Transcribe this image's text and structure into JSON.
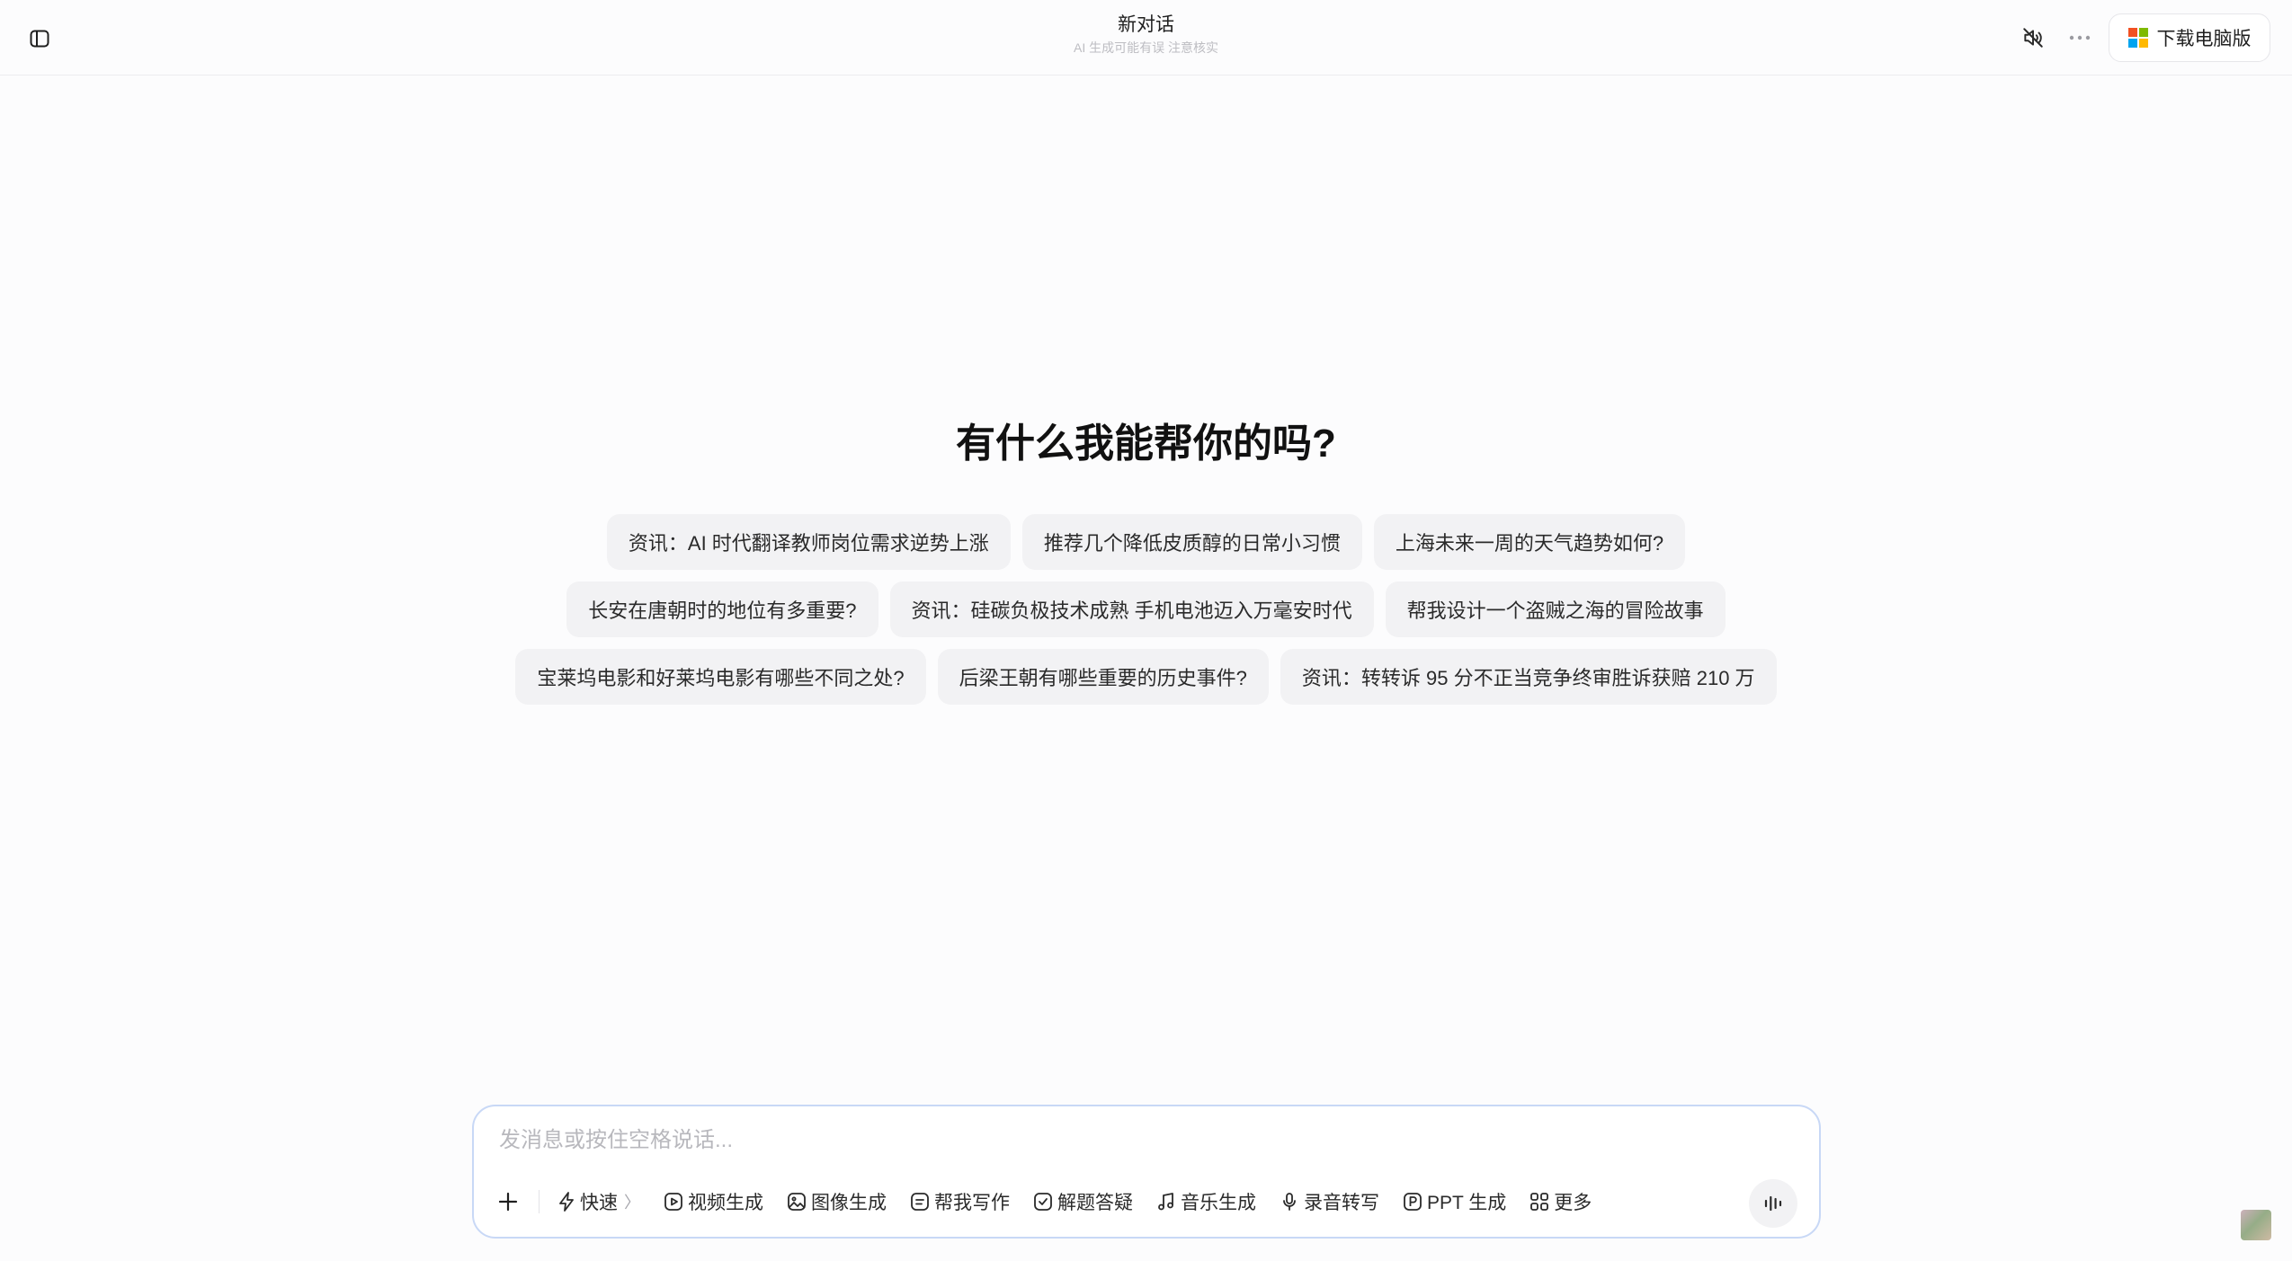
{
  "header": {
    "title": "新对话",
    "subtitle": "AI 生成可能有误 注意核实",
    "download_label": "下载电脑版",
    "icons": {
      "sidebar_toggle": "sidebar-toggle-icon",
      "mute": "speaker-muted-icon",
      "more": "more-dots-icon",
      "download": "windows-logo-icon"
    }
  },
  "main": {
    "heading": "有什么我能帮你的吗?",
    "suggestions": [
      [
        "资讯：AI 时代翻译教师岗位需求逆势上涨",
        "推荐几个降低皮质醇的日常小习惯",
        "上海未来一周的天气趋势如何?"
      ],
      [
        "长安在唐朝时的地位有多重要?",
        "资讯：硅碳负极技术成熟 手机电池迈入万毫安时代",
        "帮我设计一个盗贼之海的冒险故事"
      ],
      [
        "宝莱坞电影和好莱坞电影有哪些不同之处?",
        "后梁王朝有哪些重要的历史事件?",
        "资讯：转转诉 95 分不正当竞争终审胜诉获赔 210 万"
      ]
    ]
  },
  "composer": {
    "placeholder": "发消息或按住空格说话...",
    "value": "",
    "tools": {
      "fast": "快速",
      "fast_chevron": "〉",
      "video": "视频生成",
      "image": "图像生成",
      "writing": "帮我写作",
      "solve": "解题答疑",
      "music": "音乐生成",
      "record": "录音转写",
      "ppt": "PPT 生成",
      "more": "更多"
    }
  },
  "colors": {
    "background": "#fcfcfd",
    "chip": "#f2f2f4",
    "composer_border": "#c8d8f6",
    "ms_red": "#f25022",
    "ms_green": "#7fba00",
    "ms_blue": "#00a4ef",
    "ms_yellow": "#ffb900"
  }
}
